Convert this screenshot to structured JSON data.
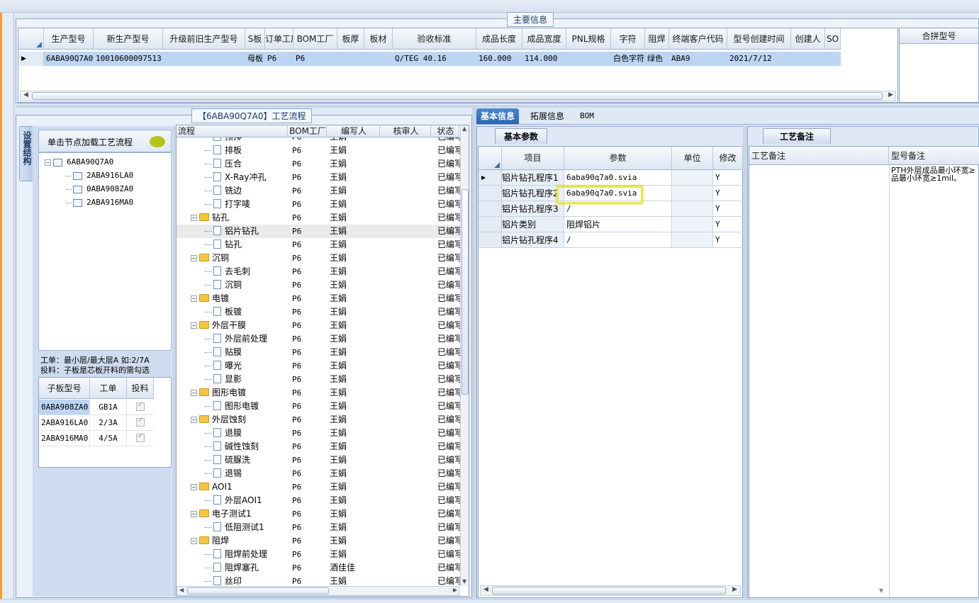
{
  "main_info": {
    "title": "主要信息",
    "columns": [
      "生产型号",
      "新生产型号",
      "升级前旧生产型号",
      "S板",
      "订单工厂",
      "BOM工厂",
      "板厚",
      "板材",
      "验收标准",
      "成品长度",
      "成品宽度",
      "PNL规格",
      "字符",
      "阻焊",
      "终端客户代码",
      "型号创建时间",
      "创建人",
      "SO"
    ],
    "row": [
      "6ABA90Q7A0",
      "10010600097513",
      "",
      "母板",
      "P6",
      "P6",
      "",
      "",
      "Q/TEG 40.16",
      "160.000",
      "114.000",
      "",
      "白色字符",
      "绿色",
      "ABA9",
      "2021/7/12",
      "",
      ""
    ],
    "merge_header": "合拼型号"
  },
  "process": {
    "title": "【6ABA90Q7A0】工艺流程",
    "vertical_tab": "设置结构",
    "load_hint": "单击节点加载工艺流程",
    "tree": [
      "6ABA90Q7A0",
      "2ABA916LA0",
      "0ABA908ZA0",
      "2ABA916MA0"
    ],
    "note_line1": "工单：最小层/最大层A 如:2/7A",
    "note_line2": "投料：子板是芯板开料的需勾选",
    "sub_columns": [
      "子板型号",
      "工单",
      "投料"
    ],
    "sub_rows": [
      {
        "model": "0ABA908ZA0",
        "order": "GB1A"
      },
      {
        "model": "2ABA916LA0",
        "order": "2/3A"
      },
      {
        "model": "2ABA916MA0",
        "order": "4/5A"
      }
    ],
    "flow_columns": [
      "流程",
      "BOM工厂",
      "编写人",
      "核审人",
      "状态"
    ],
    "flow_rows": [
      {
        "lvl": 2,
        "name": "预排",
        "bom": "P6",
        "author": "王娟",
        "status": "已编写"
      },
      {
        "lvl": 2,
        "name": "排板",
        "bom": "P6",
        "author": "王娟",
        "status": "已编写"
      },
      {
        "lvl": 2,
        "name": "压合",
        "bom": "P6",
        "author": "王娟",
        "status": "已编写"
      },
      {
        "lvl": 2,
        "name": "X-Ray冲孔",
        "bom": "P6",
        "author": "王娟",
        "status": "已编写"
      },
      {
        "lvl": 2,
        "name": "铣边",
        "bom": "P6",
        "author": "王娟",
        "status": "已编写"
      },
      {
        "lvl": 2,
        "name": "打字唛",
        "bom": "P6",
        "author": "王娟",
        "status": "已编写"
      },
      {
        "lvl": 1,
        "name": "钻孔",
        "bom": "P6",
        "author": "王娟",
        "status": "已编写"
      },
      {
        "lvl": 2,
        "name": "铝片钻孔",
        "bom": "P6",
        "author": "王娟",
        "status": "已编写"
      },
      {
        "lvl": 2,
        "name": "钻孔",
        "bom": "P6",
        "author": "王娟",
        "status": "已编写"
      },
      {
        "lvl": 1,
        "name": "沉铜",
        "bom": "P6",
        "author": "王娟",
        "status": "已编写"
      },
      {
        "lvl": 2,
        "name": "去毛刺",
        "bom": "P6",
        "author": "王娟",
        "status": "已编写"
      },
      {
        "lvl": 2,
        "name": "沉铜",
        "bom": "P6",
        "author": "王娟",
        "status": "已编写"
      },
      {
        "lvl": 1,
        "name": "电镀",
        "bom": "P6",
        "author": "王娟",
        "status": "已编写"
      },
      {
        "lvl": 2,
        "name": "板镀",
        "bom": "P6",
        "author": "王娟",
        "status": "已编写"
      },
      {
        "lvl": 1,
        "name": "外层干膜",
        "bom": "P6",
        "author": "王娟",
        "status": "已编写"
      },
      {
        "lvl": 2,
        "name": "外层前处理",
        "bom": "P6",
        "author": "王娟",
        "status": "已编写"
      },
      {
        "lvl": 2,
        "name": "贴膜",
        "bom": "P6",
        "author": "王娟",
        "status": "已编写"
      },
      {
        "lvl": 2,
        "name": "曝光",
        "bom": "P6",
        "author": "王娟",
        "status": "已编写"
      },
      {
        "lvl": 2,
        "name": "显影",
        "bom": "P6",
        "author": "王娟",
        "status": "已编写"
      },
      {
        "lvl": 1,
        "name": "图形电镀",
        "bom": "P6",
        "author": "王娟",
        "status": "已编写"
      },
      {
        "lvl": 2,
        "name": "图形电镀",
        "bom": "P6",
        "author": "王娟",
        "status": "已编写"
      },
      {
        "lvl": 1,
        "name": "外层蚀刻",
        "bom": "P6",
        "author": "王娟",
        "status": "已编写"
      },
      {
        "lvl": 2,
        "name": "退膜",
        "bom": "P6",
        "author": "王娟",
        "status": "已编写"
      },
      {
        "lvl": 2,
        "name": "碱性蚀刻",
        "bom": "P6",
        "author": "王娟",
        "status": "已编写"
      },
      {
        "lvl": 2,
        "name": "硫脲洗",
        "bom": "P6",
        "author": "王娟",
        "status": "已编写"
      },
      {
        "lvl": 2,
        "name": "退锡",
        "bom": "P6",
        "author": "王娟",
        "status": "已编写"
      },
      {
        "lvl": 1,
        "name": "AOI1",
        "bom": "P6",
        "author": "王娟",
        "status": "已编写"
      },
      {
        "lvl": 2,
        "name": "外层AOI1",
        "bom": "P6",
        "author": "王娟",
        "status": "已编写"
      },
      {
        "lvl": 1,
        "name": "电子测试1",
        "bom": "P6",
        "author": "王娟",
        "status": "已编写"
      },
      {
        "lvl": 2,
        "name": "低阻测试1",
        "bom": "P6",
        "author": "王娟",
        "status": "已编写"
      },
      {
        "lvl": 1,
        "name": "阻焊",
        "bom": "P6",
        "author": "王娟",
        "status": "已编写"
      },
      {
        "lvl": 2,
        "name": "阻焊前处理",
        "bom": "P6",
        "author": "王娟",
        "status": "已编写"
      },
      {
        "lvl": 2,
        "name": "阻焊塞孔",
        "bom": "P6",
        "author": "酒佳佳",
        "status": "已编写"
      },
      {
        "lvl": 2,
        "name": "丝印",
        "bom": "P6",
        "author": "王娟",
        "status": "已编写"
      }
    ]
  },
  "right_tabs": [
    "基本信息",
    "拓展信息",
    "BOM"
  ],
  "basic": {
    "tab": "基本参数",
    "columns": [
      "项目",
      "参数",
      "单位",
      "修改"
    ],
    "rows": [
      {
        "item": "铝片钻孔程序1",
        "param": "6aba90q7a0.svia",
        "unit": "",
        "mod": "Y"
      },
      {
        "item": "铝片钻孔程序2",
        "param": "6aba90q7a0.svia",
        "unit": "",
        "mod": "Y"
      },
      {
        "item": "铝片钻孔程序3",
        "param": "/",
        "unit": "",
        "mod": "Y"
      },
      {
        "item": "铝片类别",
        "param": "阻焊铝片",
        "unit": "",
        "mod": "Y"
      },
      {
        "item": "铝片钻孔程序4",
        "param": "/",
        "unit": "",
        "mod": "Y"
      }
    ]
  },
  "notes": {
    "tab": "工艺备注",
    "col1": "工艺备注",
    "col2": "型号备注",
    "model_note_1": "PTH外层成品最小环宽≥",
    "model_note_2": "品最小环宽≥1mil。"
  }
}
